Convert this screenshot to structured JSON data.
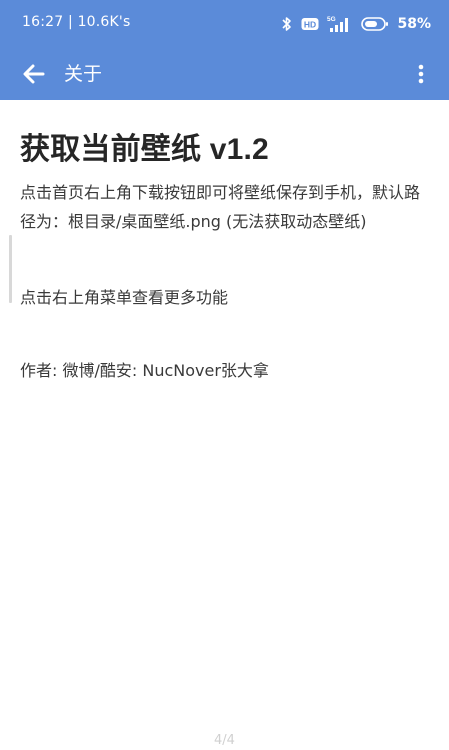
{
  "status_bar": {
    "time_speed": "16:27 | 10.6K's",
    "network_badge": "5G",
    "battery": "58%"
  },
  "toolbar": {
    "title": "关于",
    "back_icon": "arrow-left-icon",
    "menu_icon": "more-vert-icon"
  },
  "content": {
    "heading": "获取当前壁纸 v1.2",
    "paragraph1": "点击首页右上角下载按钮即可将壁纸保存到手机，默认路径为：根目录/桌面壁纸.png (无法获取动态壁纸)",
    "paragraph2": "点击右上角菜单查看更多功能",
    "paragraph3": "作者: 微博/酷安: NucNover张大拿"
  },
  "page_indicator": "4/4",
  "colors": {
    "appbar": "#5b8bd9",
    "text_primary": "#262626",
    "text_body": "#3a3a3a"
  }
}
